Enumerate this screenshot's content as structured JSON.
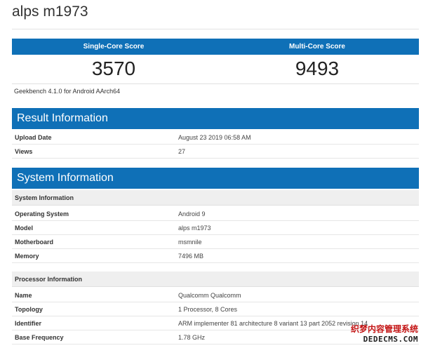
{
  "device_title": "alps m1973",
  "scores": {
    "single_label": "Single-Core Score",
    "multi_label": "Multi-Core Score",
    "single_value": "3570",
    "multi_value": "9493"
  },
  "version": "Geekbench 4.1.0 for Android AArch64",
  "result_info": {
    "heading": "Result Information",
    "rows": [
      {
        "label": "Upload Date",
        "value": "August 23 2019 06:58 AM"
      },
      {
        "label": "Views",
        "value": "27"
      }
    ]
  },
  "system_info": {
    "heading": "System Information",
    "sub1": "System Information",
    "rows1": [
      {
        "label": "Operating System",
        "value": "Android 9"
      },
      {
        "label": "Model",
        "value": "alps m1973"
      },
      {
        "label": "Motherboard",
        "value": "msmnile"
      },
      {
        "label": "Memory",
        "value": "7496 MB"
      }
    ],
    "sub2": "Processor Information",
    "rows2": [
      {
        "label": "Name",
        "value": "Qualcomm Qualcomm"
      },
      {
        "label": "Topology",
        "value": "1 Processor, 8 Cores"
      },
      {
        "label": "Identifier",
        "value": "ARM implementer 81 architecture 8 variant 13 part 2052 revision 14"
      },
      {
        "label": "Base Frequency",
        "value": "1.78 GHz"
      }
    ]
  },
  "watermark": {
    "line1": "织梦内容管理系统",
    "line2": "DEDECMS.COM"
  }
}
